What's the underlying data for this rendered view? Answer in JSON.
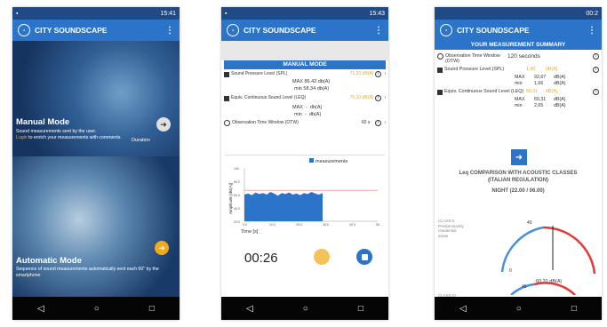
{
  "app_title": "CITY SOUNDSCAPE",
  "status_times": [
    "15:41",
    "15:43",
    "00:2"
  ],
  "phone1": {
    "manual_title": "Manual Mode",
    "manual_desc": "Sound measurements sent by the user.",
    "login_word": "Login",
    "manual_desc2": " to enrich your measurements with comments.",
    "duration_label": "Duration",
    "auto_title": "Automatic Mode",
    "auto_desc": "Sequence of sound measurements automatically sent each 60\" by the smartphone"
  },
  "phone2": {
    "section_title": "MANUAL MODE",
    "spl_label": "Sound Pressure Level (SPL)",
    "spl_value": "71.20 dB(A)",
    "spl_max_label": "MAX",
    "spl_max_value": "86.42 db(A)",
    "spl_min_label": "min",
    "spl_min_value": "58.34 db(A)",
    "leq_label": "Equiv. Continuous Sound Level (LEQ)",
    "leq_value": "75.10 dB(A)",
    "leq_max_label": "MAX",
    "leq_max_value": "db(A)",
    "leq_min_label": "min",
    "leq_min_value": "db(A)",
    "dash": "-",
    "otw_label": "Observation Time Window (OTW)",
    "otw_value": "60 s",
    "timer": "00:26"
  },
  "phone3": {
    "summary_title": "YOUR MEASUREMENT SUMMARY",
    "otw_label": "Observation Time Window (OTW)",
    "otw_value": "120 seconds",
    "spl_label": "Sound Pressure Level (SPL)",
    "spl_value": "1,90",
    "spl_unit": "dB(A)",
    "spl_max_label": "MAX",
    "spl_max": "92,67",
    "spl_min_label": "min",
    "spl_min": "1,66",
    "unit": "dB(A)",
    "leq_label": "Equiv. Continuous Sound Level (LEQ)",
    "leq_value": "60,31",
    "leq_unit": "dB(A)",
    "leq_max_label": "MAX",
    "leq_max": "60,31",
    "leq_min_label": "min",
    "leq_min": "2,65",
    "cmp_title": "Leq COMPARISON WITH ACOUSTIC CLASSES",
    "cmp_sub": "(ITALIAN REGULATION)",
    "night": "NIGHT (22.00 / 06.00)",
    "class2": "CLASS II",
    "class2_desc": "Predominantly residential areas",
    "gauge_value": "60,31 dB(A)",
    "gauge_zero": "0",
    "gauge_40": "40",
    "gauge_45": "45",
    "class3": "CLASS III"
  },
  "chart_data": {
    "type": "area",
    "series": [
      {
        "name": "measurements",
        "values": [
          50,
          52,
          49,
          54,
          51,
          53,
          50,
          55,
          52,
          48,
          53,
          51,
          54,
          50,
          52,
          49,
          53,
          51,
          55,
          52,
          50,
          53
        ]
      }
    ],
    "x_ticks": [
      "0.0",
      "10.0",
      "20.0",
      "30.0",
      "40.0",
      "50."
    ],
    "y_ticks": [
      "100",
      "80.0",
      "60.0",
      "40.0",
      "20.0"
    ],
    "xlabel": "Time [s]",
    "ylabel": "Amplitude [dB(A)]",
    "ylim": [
      0,
      100
    ],
    "xlim": [
      0,
      50
    ]
  },
  "colors": {
    "primary": "#2b74c9",
    "accent": "#f2a81f",
    "red": "#e53935"
  }
}
